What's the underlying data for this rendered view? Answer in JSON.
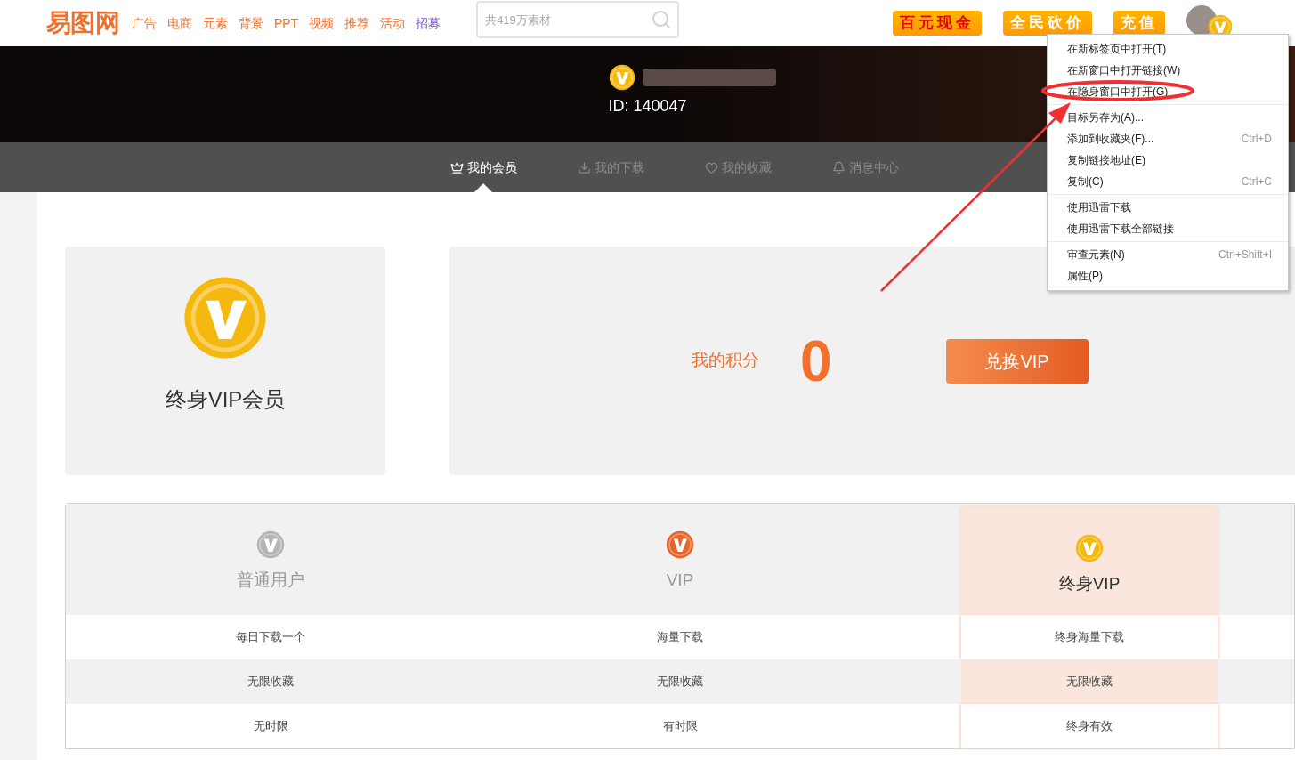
{
  "header": {
    "logo": "易图网",
    "nav": [
      {
        "label": "广告",
        "color": "#f0712c"
      },
      {
        "label": "电商",
        "color": "#f0712c"
      },
      {
        "label": "元素",
        "color": "#f0712c"
      },
      {
        "label": "背景",
        "color": "#f0712c"
      },
      {
        "label": "PPT",
        "color": "#f0712c"
      },
      {
        "label": "视频",
        "color": "#f0712c"
      },
      {
        "label": "推荐",
        "color": "#f0712c"
      },
      {
        "label": "活动",
        "color": "#f0712c"
      },
      {
        "label": "招募",
        "color": "#7b4fd0"
      }
    ],
    "search": {
      "placeholder": "共419万素材"
    },
    "promo_buttons": [
      "百元现金",
      "全民砍价",
      "充值"
    ]
  },
  "profile": {
    "id_text": "ID: 140047"
  },
  "tabs": [
    {
      "label": "我的会员",
      "selected": true
    },
    {
      "label": "我的下载",
      "selected": false
    },
    {
      "label": "我的收藏",
      "selected": false
    },
    {
      "label": "消息中心",
      "selected": false
    }
  ],
  "membership_card": {
    "title": "终身VIP会员"
  },
  "points": {
    "label": "我的积分",
    "value": "0",
    "button": "兑换VIP"
  },
  "plans_table": {
    "plans": [
      {
        "name": "普通用户",
        "color": "#b5b5b5",
        "selected": false
      },
      {
        "name": "VIP",
        "color": "#e8662a",
        "selected": false
      },
      {
        "name": "终身VIP",
        "color": "#f5b80f",
        "selected": true
      }
    ],
    "rows": [
      [
        "每日下载一个",
        "海量下载",
        "终身海量下载"
      ],
      [
        "无限收藏",
        "无限收藏",
        "无限收藏"
      ],
      [
        "无时限",
        "有时限",
        "终身有效"
      ]
    ]
  },
  "context_menu": {
    "groups": [
      [
        {
          "label": "在新标签页中打开(T)"
        },
        {
          "label": "在新窗口中打开链接(W)"
        },
        {
          "label": "在隐身窗口中打开(G)"
        }
      ],
      [
        {
          "label": "目标另存为(A)..."
        },
        {
          "label": "添加到收藏夹(F)...",
          "shortcut": "Ctrl+D"
        },
        {
          "label": "复制链接地址(E)"
        },
        {
          "label": "复制(C)",
          "shortcut": "Ctrl+C"
        }
      ],
      [
        {
          "label": "使用迅雷下载"
        },
        {
          "label": "使用迅雷下载全部链接"
        }
      ],
      [
        {
          "label": "审查元素(N)",
          "shortcut": "Ctrl+Shift+I"
        },
        {
          "label": "属性(P)"
        }
      ]
    ]
  }
}
